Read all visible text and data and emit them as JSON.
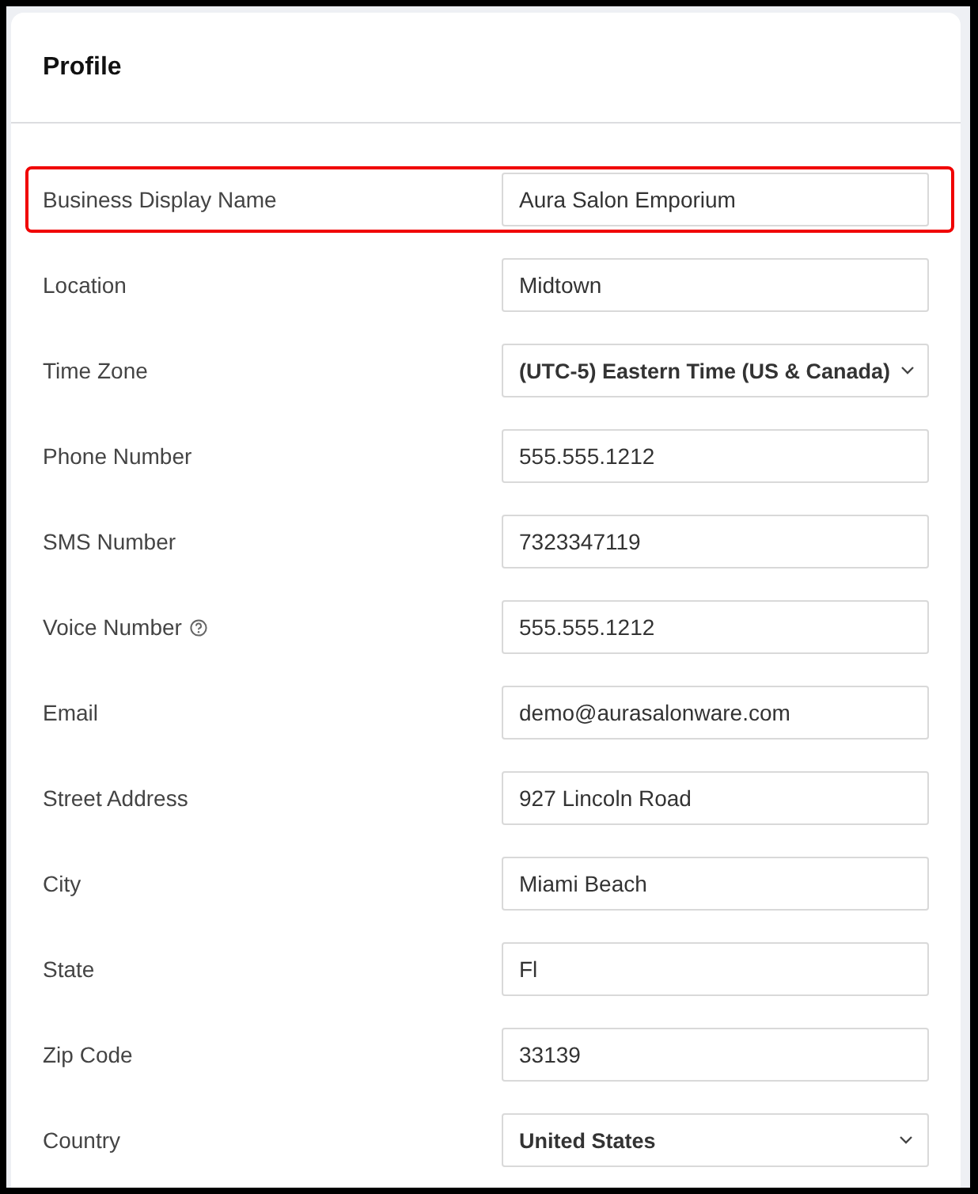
{
  "panel": {
    "title": "Profile"
  },
  "fields": [
    {
      "kind": "text",
      "label": "Business Display Name",
      "value": "Aura Salon Emporium",
      "highlighted": true,
      "help": false
    },
    {
      "kind": "text",
      "label": "Location",
      "value": "Midtown",
      "highlighted": false,
      "help": false
    },
    {
      "kind": "select",
      "label": "Time Zone",
      "value": "(UTC-5) Eastern Time (US & Canada)",
      "highlighted": false,
      "help": false
    },
    {
      "kind": "text",
      "label": "Phone Number",
      "value": "555.555.1212",
      "highlighted": false,
      "help": false
    },
    {
      "kind": "text",
      "label": "SMS Number",
      "value": "7323347119",
      "highlighted": false,
      "help": false
    },
    {
      "kind": "text",
      "label": "Voice Number",
      "value": "555.555.1212",
      "highlighted": false,
      "help": true
    },
    {
      "kind": "text",
      "label": "Email",
      "value": "demo@aurasalonware.com",
      "highlighted": false,
      "help": false
    },
    {
      "kind": "text",
      "label": "Street Address",
      "value": "927 Lincoln Road",
      "highlighted": false,
      "help": false
    },
    {
      "kind": "text",
      "label": "City",
      "value": "Miami Beach",
      "highlighted": false,
      "help": false
    },
    {
      "kind": "text",
      "label": "State",
      "value": "Fl",
      "highlighted": false,
      "help": false
    },
    {
      "kind": "text",
      "label": "Zip Code",
      "value": "33139",
      "highlighted": false,
      "help": false
    },
    {
      "kind": "select",
      "label": "Country",
      "value": "United States",
      "highlighted": false,
      "help": false
    }
  ]
}
